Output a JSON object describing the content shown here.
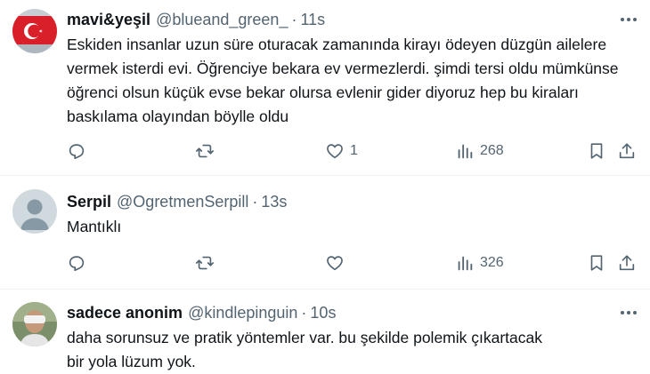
{
  "colors": {
    "text": "#0f1419",
    "secondary": "#536471",
    "divider": "#eff3f4"
  },
  "tweets": [
    {
      "name": "mavi&yeşil",
      "handle": "@blueand_green_",
      "dot": "·",
      "time": "11s",
      "text": "Eskiden insanlar uzun süre oturacak zamanında kirayı ödeyen düzgün ailelere vermek isterdi evi. Öğrenciye bekara ev vermezlerdi. şimdi tersi oldu mümkünse öğrenci olsun küçük evse bekar olursa evlenir gider diyoruz hep bu kiraları baskılama olayından böylle oldu",
      "likes": "1",
      "views": "268",
      "avatar_icon": "turkish-flag-avatar"
    },
    {
      "name": "Serpil",
      "handle": "@OgretmenSerpill",
      "dot": "·",
      "time": "13s",
      "text": "Mantıklı",
      "likes": "",
      "views": "326",
      "avatar_icon": "default-person-avatar"
    },
    {
      "name": "sadece anonim",
      "handle": "@kindlepinguin",
      "dot": "·",
      "time": "10s",
      "text": "daha sorunsuz ve pratik yöntemler var. bu şekilde polemik çıkartacak bir yola lüzum yok.",
      "avatar_icon": "photo-avatar"
    }
  ]
}
